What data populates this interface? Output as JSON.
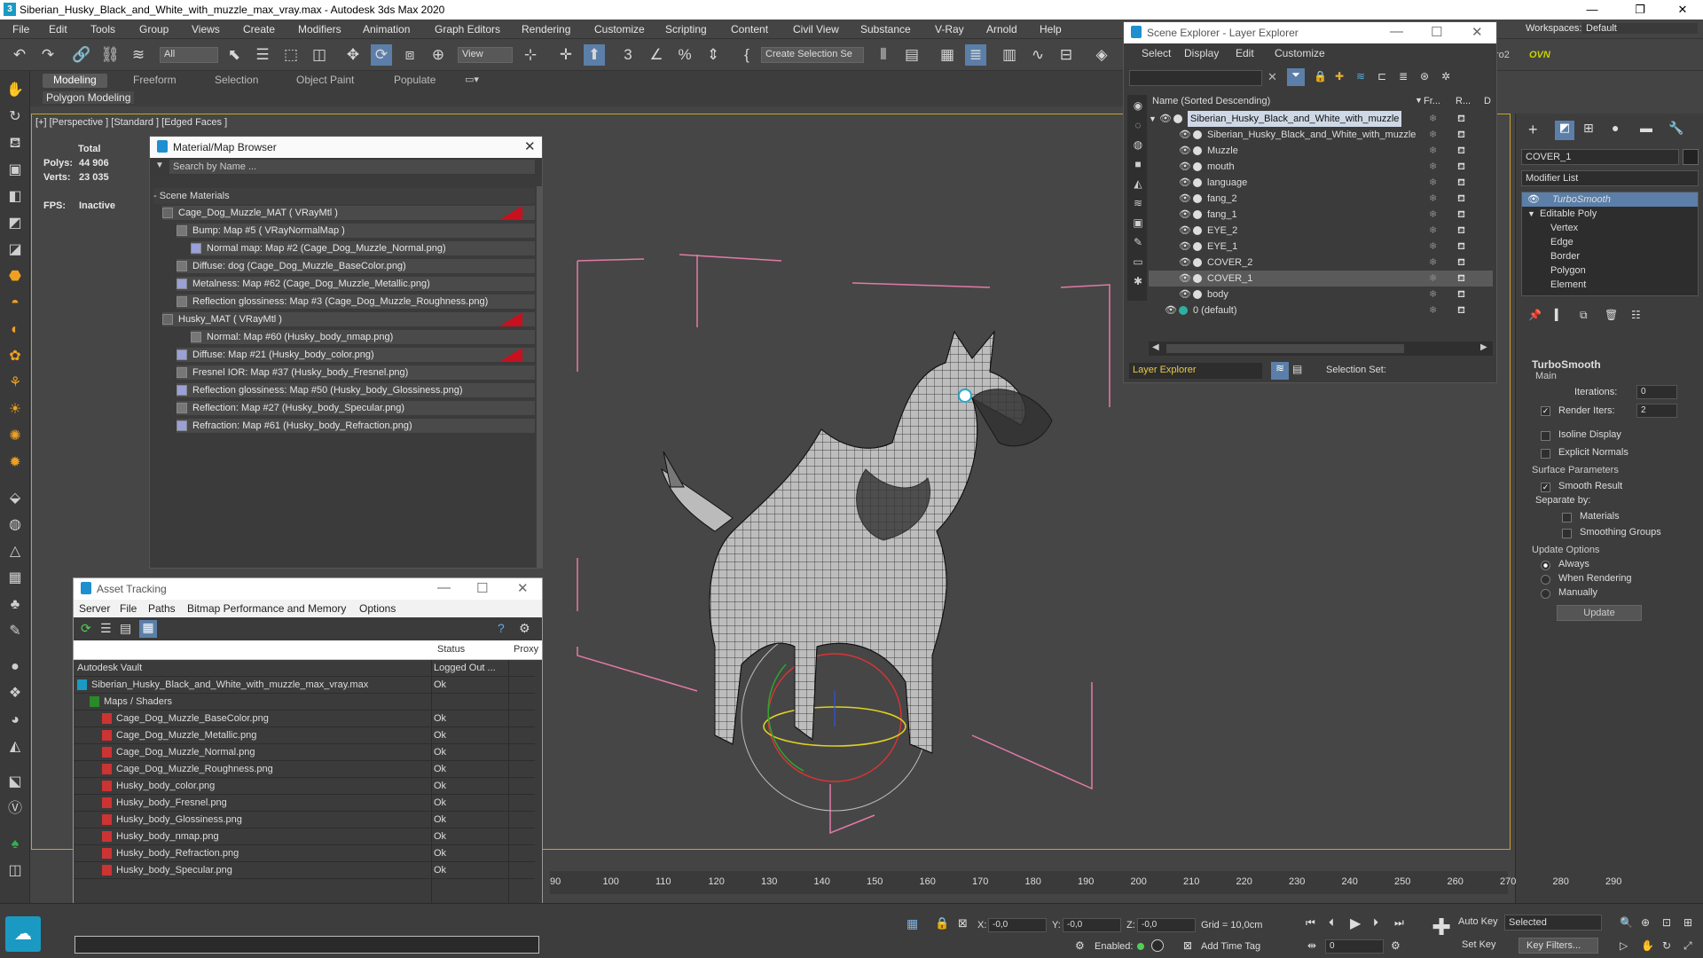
{
  "window": {
    "title": "Siberian_Husky_Black_and_White_with_muzzle_max_vray.max - Autodesk 3ds Max 2020",
    "controls": [
      "—",
      "❐",
      "✕"
    ]
  },
  "menu": [
    "File",
    "Edit",
    "Tools",
    "Group",
    "Views",
    "Create",
    "Modifiers",
    "Animation",
    "Graph Editors",
    "Rendering",
    "Customize",
    "Scripting",
    "Content",
    "Civil View",
    "Substance",
    "V-Ray",
    "Arnold",
    "Help"
  ],
  "workspace": {
    "label": "Workspaces:",
    "value": "Default"
  },
  "toolbar": {
    "filter_select": "All",
    "refcoord_select": "View",
    "selection_set": "Create Selection Se",
    "right_labels": [
      "ro2",
      "OVN"
    ]
  },
  "ribbon": {
    "tabs": [
      "Modeling",
      "Freeform",
      "Selection",
      "Object Paint",
      "Populate"
    ],
    "active_tab": "Modeling",
    "sub_label": "Polygon Modeling"
  },
  "viewport": {
    "label": "[+] [Perspective ] [Standard ] [Edged Faces ]",
    "stats": {
      "total_label": "Total",
      "polys_label": "Polys:",
      "polys": "44 906",
      "verts_label": "Verts:",
      "verts": "23 035",
      "fps_label": "FPS:",
      "fps": "Inactive"
    }
  },
  "material_browser": {
    "title": "Material/Map Browser",
    "search_placeholder": "Search by Name ...",
    "section": "- Scene Materials",
    "items": [
      {
        "label": "Cage_Dog_Muzzle_MAT  ( VRayMtl )",
        "indent": 0,
        "red": true
      },
      {
        "label": "Bump: Map #5  ( VRayNormalMap )",
        "indent": 1,
        "red": false
      },
      {
        "label": "Normal map: Map #2 (Cage_Dog_Muzzle_Normal.png)",
        "indent": 2,
        "red": false
      },
      {
        "label": "Diffuse: dog (Cage_Dog_Muzzle_BaseColor.png)",
        "indent": 1,
        "red": false
      },
      {
        "label": "Metalness: Map #62 (Cage_Dog_Muzzle_Metallic.png)",
        "indent": 1,
        "red": false
      },
      {
        "label": "Reflection glossiness: Map #3 (Cage_Dog_Muzzle_Roughness.png)",
        "indent": 1,
        "red": false
      },
      {
        "label": "Husky_MAT  ( VRayMtl )",
        "indent": 0,
        "red": true
      },
      {
        "label": "Normal: Map #60 (Husky_body_nmap.png)",
        "indent": 2,
        "red": false
      },
      {
        "label": "Diffuse: Map #21 (Husky_body_color.png)",
        "indent": 1,
        "red": true
      },
      {
        "label": "Fresnel IOR: Map #37 (Husky_body_Fresnel.png)",
        "indent": 1,
        "red": false
      },
      {
        "label": "Reflection glossiness: Map #50 (Husky_body_Glossiness.png)",
        "indent": 1,
        "red": false
      },
      {
        "label": "Reflection: Map #27 (Husky_body_Specular.png)",
        "indent": 1,
        "red": false
      },
      {
        "label": "Refraction: Map #61 (Husky_body_Refraction.png)",
        "indent": 1,
        "red": false
      }
    ]
  },
  "asset_tracking": {
    "title": "Asset Tracking",
    "menu": [
      "Server",
      "File",
      "Paths",
      "Bitmap Performance and Memory",
      "Options"
    ],
    "columns": [
      "",
      "Status",
      "Proxy"
    ],
    "rows": [
      {
        "name": "Autodesk Vault",
        "status": "Logged Out ...",
        "indent": 0
      },
      {
        "name": "Siberian_Husky_Black_and_White_with_muzzle_max_vray.max",
        "status": "Ok",
        "indent": 0
      },
      {
        "name": "Maps / Shaders",
        "status": "",
        "indent": 1
      },
      {
        "name": "Cage_Dog_Muzzle_BaseColor.png",
        "status": "Ok",
        "indent": 2
      },
      {
        "name": "Cage_Dog_Muzzle_Metallic.png",
        "status": "Ok",
        "indent": 2
      },
      {
        "name": "Cage_Dog_Muzzle_Normal.png",
        "status": "Ok",
        "indent": 2
      },
      {
        "name": "Cage_Dog_Muzzle_Roughness.png",
        "status": "Ok",
        "indent": 2
      },
      {
        "name": "Husky_body_color.png",
        "status": "Ok",
        "indent": 2
      },
      {
        "name": "Husky_body_Fresnel.png",
        "status": "Ok",
        "indent": 2
      },
      {
        "name": "Husky_body_Glossiness.png",
        "status": "Ok",
        "indent": 2
      },
      {
        "name": "Husky_body_nmap.png",
        "status": "Ok",
        "indent": 2
      },
      {
        "name": "Husky_body_Refraction.png",
        "status": "Ok",
        "indent": 2
      },
      {
        "name": "Husky_body_Specular.png",
        "status": "Ok",
        "indent": 2
      }
    ]
  },
  "scene_explorer": {
    "title": "Scene Explorer - Layer Explorer",
    "menu": [
      "Select",
      "Display",
      "Edit",
      "Customize"
    ],
    "columns": [
      "Name (Sorted Descending)",
      "Fr...",
      "R...",
      "D"
    ],
    "rows": [
      {
        "name": "Siberian_Husky_Black_and_White_with_muzzle",
        "indent": 0,
        "selected": false,
        "root": true
      },
      {
        "name": "Siberian_Husky_Black_and_White_with_muzzle",
        "indent": 1,
        "selected": false
      },
      {
        "name": "Muzzle",
        "indent": 1,
        "selected": false
      },
      {
        "name": "mouth",
        "indent": 1,
        "selected": false
      },
      {
        "name": "language",
        "indent": 1,
        "selected": false
      },
      {
        "name": "fang_2",
        "indent": 1,
        "selected": false
      },
      {
        "name": "fang_1",
        "indent": 1,
        "selected": false
      },
      {
        "name": "EYE_2",
        "indent": 1,
        "selected": false
      },
      {
        "name": "EYE_1",
        "indent": 1,
        "selected": false
      },
      {
        "name": "COVER_2",
        "indent": 1,
        "selected": false
      },
      {
        "name": "COVER_1",
        "indent": 1,
        "selected": true
      },
      {
        "name": "body",
        "indent": 1,
        "selected": false
      },
      {
        "name": "0 (default)",
        "indent": 0,
        "selected": false
      }
    ],
    "footer_select": "Layer Explorer",
    "footer_label": "Selection Set:"
  },
  "command_panel": {
    "object_name": "COVER_1",
    "modifier_list": "Modifier List",
    "stack": [
      {
        "label": "TurboSmooth",
        "active": true,
        "indent": 0
      },
      {
        "label": "Editable Poly",
        "active": false,
        "indent": 0
      },
      {
        "label": "Vertex",
        "active": false,
        "indent": 1
      },
      {
        "label": "Edge",
        "active": false,
        "indent": 1
      },
      {
        "label": "Border",
        "active": false,
        "indent": 1
      },
      {
        "label": "Polygon",
        "active": false,
        "indent": 1
      },
      {
        "label": "Element",
        "active": false,
        "indent": 1
      }
    ],
    "rollout_title": "TurboSmooth",
    "main_label": "Main",
    "iterations_label": "Iterations:",
    "iterations": "0",
    "render_iters_label": "Render Iters:",
    "render_iters": "2",
    "isoline": "Isoline Display",
    "explicit": "Explicit Normals",
    "surface_label": "Surface Parameters",
    "smooth_result": "Smooth Result",
    "separate_label": "Separate by:",
    "materials": "Materials",
    "smoothing_groups": "Smoothing Groups",
    "update_label": "Update Options",
    "always": "Always",
    "when_rendering": "When Rendering",
    "manually": "Manually",
    "update_button": "Update"
  },
  "timeline": {
    "ticks": [
      "90",
      "100",
      "110",
      "120",
      "130",
      "140",
      "150",
      "160",
      "170",
      "180",
      "190",
      "200",
      "210",
      "220",
      "230",
      "240",
      "250",
      "260",
      "270",
      "280",
      "290"
    ]
  },
  "status": {
    "x_label": "X:",
    "x": "-0,0",
    "y_label": "Y:",
    "y": "-0,0",
    "z_label": "Z:",
    "z": "-0,0",
    "grid": "Grid = 10,0cm",
    "enabled": "Enabled:",
    "add_time_tag": "Add Time Tag",
    "auto_key": "Auto Key",
    "set_key": "Set Key",
    "selected": "Selected",
    "key_filters": "Key Filters...",
    "frame": "0"
  },
  "colors": {
    "accent_blue": "#1f8fd0",
    "selection_red": "#c8101e",
    "viewport_border": "#c9a227",
    "bbox_pink": "#e37aa7"
  }
}
